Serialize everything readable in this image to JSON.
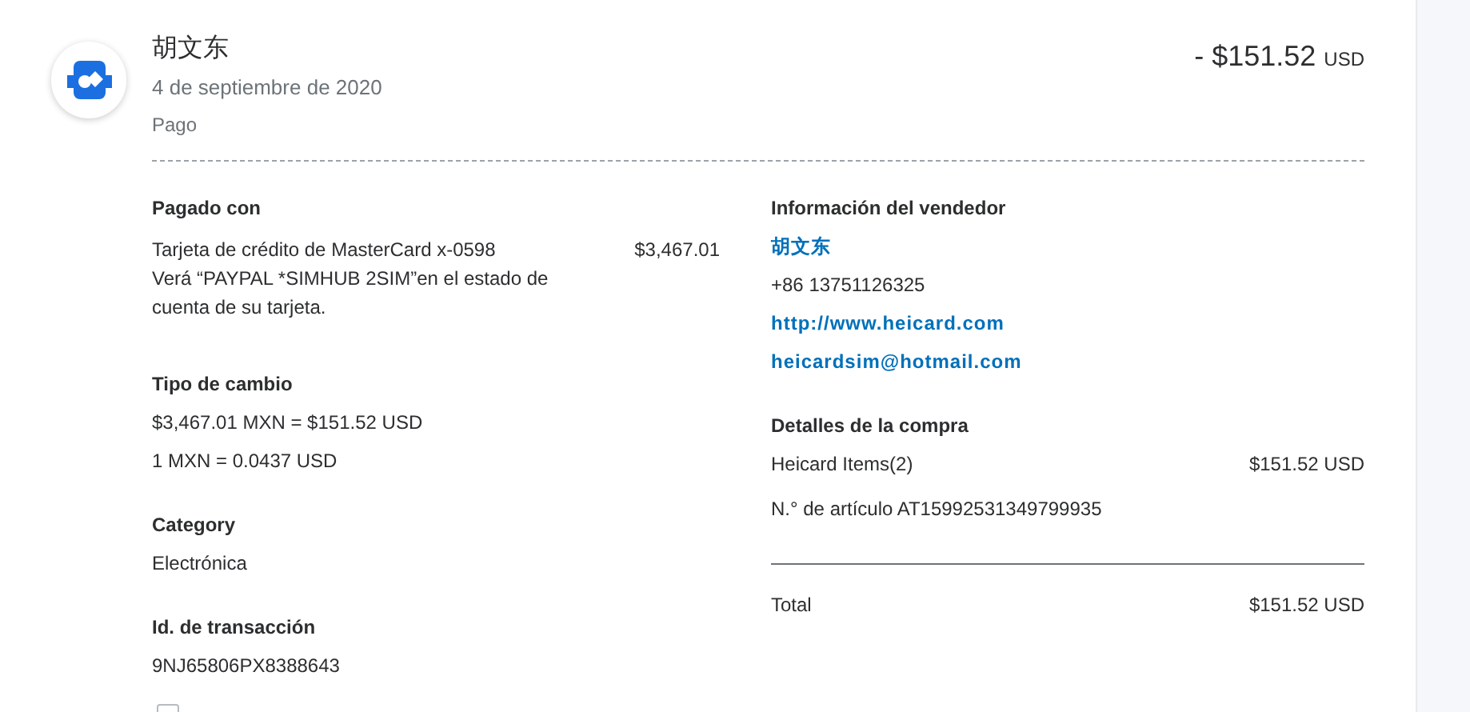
{
  "header": {
    "merchant": "胡文东",
    "date": "4 de septiembre de 2020",
    "type": "Pago",
    "amount": "- $151.52",
    "currency": "USD"
  },
  "paid_with": {
    "heading": "Pagado con",
    "method": "Tarjeta de crédito de MasterCard x-0598",
    "amount": "$3,467.01",
    "note": "Verá “PAYPAL *SIMHUB 2SIM”en el estado de cuenta de su tarjeta."
  },
  "exchange": {
    "heading": "Tipo de cambio",
    "lines": [
      "$3,467.01 MXN = $151.52 USD",
      "1 MXN = 0.0437 USD"
    ]
  },
  "category": {
    "heading": "Category",
    "value": "Electrónica"
  },
  "transaction": {
    "heading": "Id. de transacción",
    "value": "9NJ65806PX8388643"
  },
  "seller": {
    "heading": "Información del vendedor",
    "lines": [
      {
        "kind": "link",
        "text": "胡文东"
      },
      {
        "kind": "text",
        "text": "+86 13751126325"
      },
      {
        "kind": "link",
        "text": "http://www.heicard.com"
      },
      {
        "kind": "link",
        "text": "heicardsim@hotmail.com"
      }
    ]
  },
  "purchase": {
    "heading": "Detalles de la compra",
    "item": "Heicard Items(2)",
    "item_amount": "$151.52 USD",
    "item_number": "N.° de artículo AT15992531349799935",
    "total_label": "Total",
    "total": "$151.52 USD"
  },
  "footer_checkbox": {
    "checked": false
  }
}
